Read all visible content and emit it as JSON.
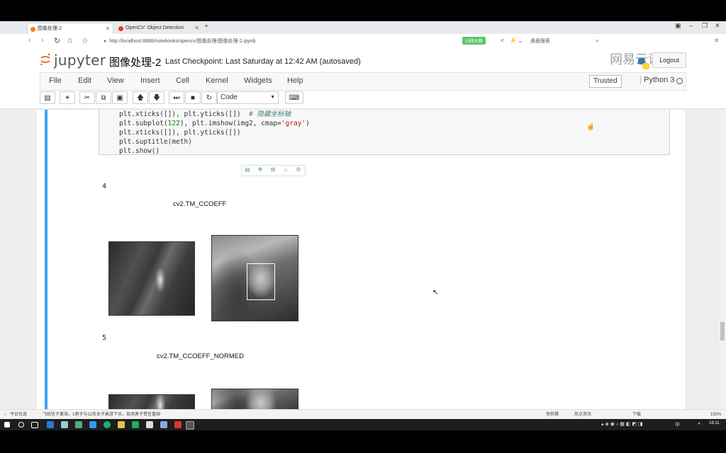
{
  "browser": {
    "tabs": [
      {
        "label": "图像处理-2",
        "active": true
      },
      {
        "label": "OpenCV: Object Detection",
        "active": false
      }
    ],
    "new_tab": "+",
    "url": "http://localhost:8888/notebooks/opencv/图像处理/图像处理-2.ipynb",
    "badge": "15倍大图",
    "search_placeholder": "桌面搜索",
    "window_controls": [
      "▣",
      "–",
      "❐",
      "✕"
    ]
  },
  "jupyter": {
    "logo_text": "jupyter",
    "notebook_title": "图像处理-2",
    "checkpoint": "Last Checkpoint: Last Saturday at 12:42 AM (autosaved)",
    "logout_label": "Logout",
    "watermark": "网易云课堂",
    "menu": [
      "File",
      "Edit",
      "View",
      "Insert",
      "Cell",
      "Kernel",
      "Widgets",
      "Help"
    ],
    "trusted_label": "Trusted",
    "kernel_name": "Python 3",
    "cell_type": "Code"
  },
  "code_lines": [
    [
      {
        "t": "plt.xticks([]), plt.yticks([])  ",
        "c": ""
      },
      {
        "t": "# 隐藏坐标轴",
        "c": "cmt"
      }
    ],
    [
      {
        "t": "plt.subplot(",
        "c": ""
      },
      {
        "t": "122",
        "c": "num"
      },
      {
        "t": "), plt.imshow(img2, cmap=",
        "c": ""
      },
      {
        "t": "'gray'",
        "c": "str"
      },
      {
        "t": ")",
        "c": ""
      }
    ],
    [
      {
        "t": "plt.xticks([]), plt.yticks([])",
        "c": ""
      }
    ],
    [
      {
        "t": "plt.suptitle(meth)",
        "c": ""
      }
    ],
    [
      {
        "t": "plt.show()",
        "c": ""
      }
    ]
  ],
  "outputs": [
    {
      "number": "4",
      "title": "cv2.TM_CCOEFF"
    },
    {
      "number": "5",
      "title": "cv2.TM_CCOEFF_NORMED"
    }
  ],
  "statusbar": {
    "left1": "今日优选",
    "left2": "飞机坠于黄海，1男子与12名女子乘游下水，现场男子责任重国",
    "right": [
      "快剪辑",
      "热点资讯",
      "下载",
      "150%"
    ]
  },
  "taskbar": {
    "time": "16:11",
    "tray_text": "中"
  }
}
